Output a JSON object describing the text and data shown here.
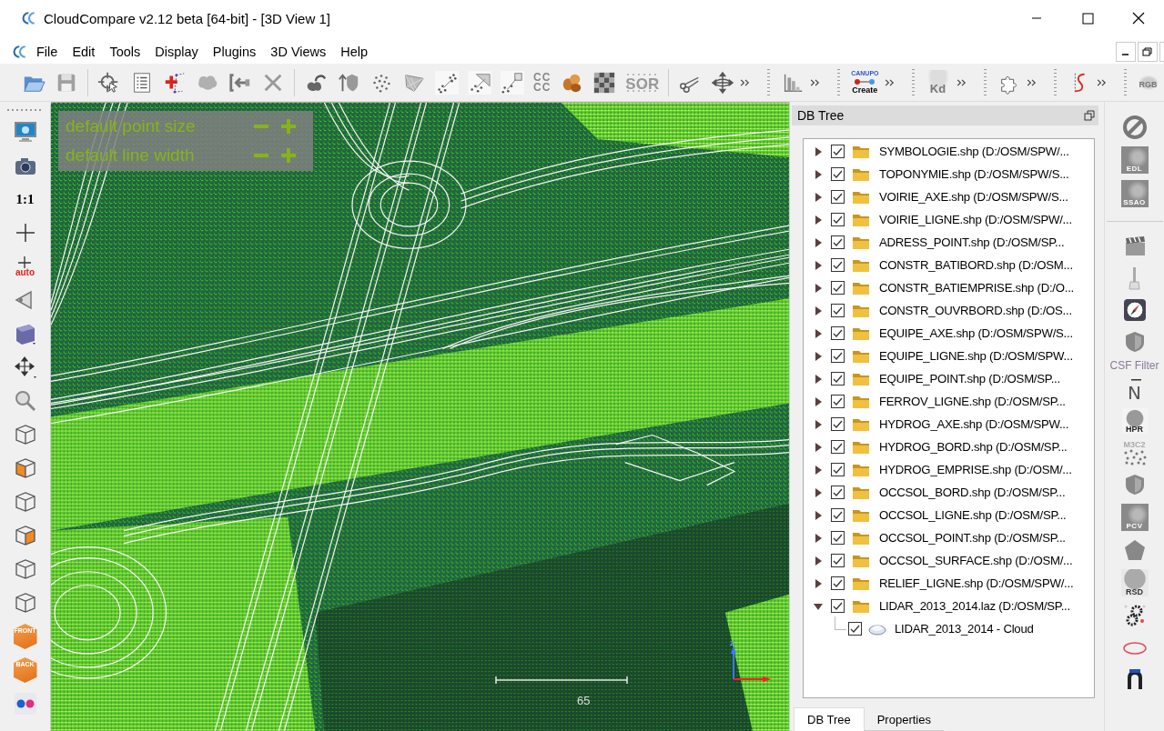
{
  "window": {
    "title": "CloudCompare v2.12 beta [64-bit] - [3D View 1]"
  },
  "menu_bar": {
    "items": [
      "File",
      "Edit",
      "Tools",
      "Display",
      "Plugins",
      "3D Views",
      "Help"
    ]
  },
  "main_toolbar": {
    "compare_label": [
      "CC",
      "CC"
    ],
    "sor_label": "SOR",
    "canupo_label": "CANUPO",
    "canupo_action": "Create",
    "kdtree_label": "Kd",
    "rgb_label": "RGB"
  },
  "view_toolbar": {
    "zoom_label": "1:1",
    "auto_label": "auto",
    "front_label": "FRONT",
    "back_label": "BACK"
  },
  "plugin_toolbar": {
    "edl_label": "EDL",
    "ssao_label": "SSAO",
    "csf_label": "CSF Filter",
    "north_label": "N",
    "hpr_label": "HPR",
    "m3c2_label": "M3C2",
    "pcv_label": "PCV",
    "rsd_label": "RSD"
  },
  "view_3d": {
    "overlay": [
      {
        "label": "default point size"
      },
      {
        "label": "default line width"
      }
    ],
    "scale_label": "65",
    "axis_label": "Z"
  },
  "db_tree": {
    "title": "DB Tree",
    "items": [
      {
        "kind": "folder",
        "label": "SYMBOLOGIE.shp (D:/OSM/SPW/...",
        "checked": true,
        "expanded": false
      },
      {
        "kind": "folder",
        "label": "TOPONYMIE.shp (D:/OSM/SPW/S...",
        "checked": true,
        "expanded": false
      },
      {
        "kind": "folder",
        "label": "VOIRIE_AXE.shp (D:/OSM/SPW/S...",
        "checked": true,
        "expanded": false
      },
      {
        "kind": "folder",
        "label": "VOIRIE_LIGNE.shp (D:/OSM/SPW/...",
        "checked": true,
        "expanded": false
      },
      {
        "kind": "folder",
        "label": "ADRESS_POINT.shp (D:/OSM/SP...",
        "checked": true,
        "expanded": false
      },
      {
        "kind": "folder",
        "label": "CONSTR_BATIBORD.shp (D:/OSM...",
        "checked": true,
        "expanded": false
      },
      {
        "kind": "folder",
        "label": "CONSTR_BATIEMPRISE.shp (D:/O...",
        "checked": true,
        "expanded": false
      },
      {
        "kind": "folder",
        "label": "CONSTR_OUVRBORD.shp (D:/OS...",
        "checked": true,
        "expanded": false
      },
      {
        "kind": "folder",
        "label": "EQUIPE_AXE.shp (D:/OSM/SPW/S...",
        "checked": true,
        "expanded": false
      },
      {
        "kind": "folder",
        "label": "EQUIPE_LIGNE.shp (D:/OSM/SPW...",
        "checked": true,
        "expanded": false
      },
      {
        "kind": "folder",
        "label": "EQUIPE_POINT.shp (D:/OSM/SP...",
        "checked": true,
        "expanded": false
      },
      {
        "kind": "folder",
        "label": "FERROV_LIGNE.shp (D:/OSM/SP...",
        "checked": true,
        "expanded": false
      },
      {
        "kind": "folder",
        "label": "HYDROG_AXE.shp (D:/OSM/SPW...",
        "checked": true,
        "expanded": false
      },
      {
        "kind": "folder",
        "label": "HYDROG_BORD.shp (D:/OSM/SP...",
        "checked": true,
        "expanded": false
      },
      {
        "kind": "folder",
        "label": "HYDROG_EMPRISE.shp (D:/OSM/...",
        "checked": true,
        "expanded": false
      },
      {
        "kind": "folder",
        "label": "OCCSOL_BORD.shp (D:/OSM/SP...",
        "checked": true,
        "expanded": false
      },
      {
        "kind": "folder",
        "label": "OCCSOL_LIGNE.shp (D:/OSM/SP...",
        "checked": true,
        "expanded": false
      },
      {
        "kind": "folder",
        "label": "OCCSOL_POINT.shp (D:/OSM/SP...",
        "checked": true,
        "expanded": false
      },
      {
        "kind": "folder",
        "label": "OCCSOL_SURFACE.shp (D:/OSM/...",
        "checked": true,
        "expanded": false
      },
      {
        "kind": "folder",
        "label": "RELIEF_LIGNE.shp (D:/OSM/SPW/...",
        "checked": true,
        "expanded": false
      },
      {
        "kind": "folder",
        "label": "LIDAR_2013_2014.laz (D:/OSM/SP...",
        "checked": true,
        "expanded": true,
        "children": [
          {
            "kind": "cloud",
            "label": "LIDAR_2013_2014 - Cloud",
            "checked": true
          }
        ]
      }
    ],
    "tabs": [
      {
        "label": "DB Tree",
        "selected": true
      },
      {
        "label": "Properties",
        "selected": false
      }
    ]
  }
}
